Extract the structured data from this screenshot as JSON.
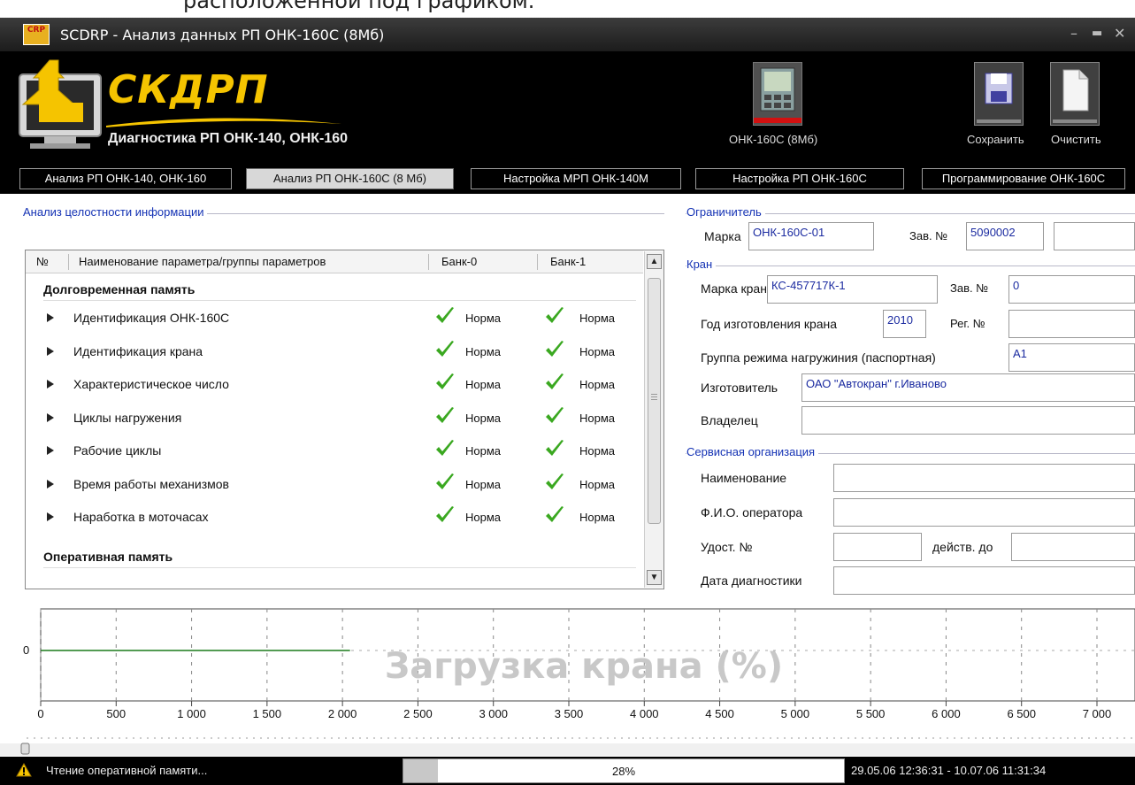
{
  "doc_caption": "расположенной под графиком.",
  "window": {
    "icon_text": "CRP",
    "title": "SCDRP - Анализ данных РП ОНК-160С (8Мб)"
  },
  "header": {
    "logo_text": "СКДРП",
    "subtitle": "Диагностика РП ОНК-140, ОНК-160",
    "device_label": "ОНК-160С (8Мб)",
    "save_label": "Сохранить",
    "clear_label": "Очистить"
  },
  "tabs": [
    {
      "label": "Анализ РП ОНК-140, ОНК-160",
      "active": false
    },
    {
      "label": "Анализ РП ОНК-160С (8 Мб)",
      "active": true
    },
    {
      "label": "Настройка МРП ОНК-140М",
      "active": false
    },
    {
      "label": "Настройка РП ОНК-160С",
      "active": false
    },
    {
      "label": "Программирование ОНК-160С",
      "active": false
    }
  ],
  "integrity": {
    "title": "Анализ целостности информации",
    "columns": [
      "№",
      "Наименование параметра/группы параметров",
      "Банк-0",
      "Банк-1"
    ],
    "section1": "Долговременная память",
    "rows": [
      {
        "name": "Идентификация ОНК-160С",
        "bank0": "Норма",
        "bank1": "Норма"
      },
      {
        "name": "Идентификация крана",
        "bank0": "Норма",
        "bank1": "Норма"
      },
      {
        "name": "Характеристическое число",
        "bank0": "Норма",
        "bank1": "Норма"
      },
      {
        "name": "Циклы нагружения",
        "bank0": "Норма",
        "bank1": "Норма"
      },
      {
        "name": "Рабочие циклы",
        "bank0": "Норма",
        "bank1": "Норма"
      },
      {
        "name": "Время работы механизмов",
        "bank0": "Норма",
        "bank1": "Норма"
      },
      {
        "name": "Наработка в моточасах",
        "bank0": "Норма",
        "bank1": "Норма"
      }
    ],
    "section2": "Оперативная память"
  },
  "limiter": {
    "title": "Ограничитель",
    "mark_label": "Марка",
    "mark_value": "ОНК-160С-01",
    "serial_label": "Зав. №",
    "serial_value": "5090002",
    "extra_value": ""
  },
  "crane": {
    "title": "Кран",
    "mark_label": "Марка крана",
    "mark_value": "КС-457717К-1",
    "serial_label": "Зав. №",
    "serial_value": "0",
    "year_label": "Год изготовления крана",
    "year_value": "2010",
    "reg_label": "Рег. №",
    "reg_value": "",
    "group_label": "Группа режима нагружиния (паспортная)",
    "group_value": "А1",
    "maker_label": "Изготовитель",
    "maker_value": "ОАО \"Автокран\" г.Иваново",
    "owner_label": "Владелец",
    "owner_value": ""
  },
  "service": {
    "title": "Сервисная организация",
    "name_label": "Наименование",
    "name_value": "",
    "operator_label": "Ф.И.О. оператора",
    "operator_value": "",
    "cert_label": "Удост. №",
    "cert_value": "",
    "valid_label": "действ. до",
    "valid_value": "",
    "date_label": "Дата диагностики",
    "date_value": ""
  },
  "chart_data": {
    "type": "line",
    "title": "Загрузка крана (%)",
    "xlim": [
      0,
      7000
    ],
    "x_ticks": [
      0,
      500,
      1000,
      1500,
      2000,
      2500,
      3000,
      3500,
      4000,
      4500,
      5000,
      5500,
      6000,
      6500,
      7000
    ],
    "x_tick_labels": [
      "0",
      "500",
      "1 000",
      "1 500",
      "2 000",
      "2 500",
      "3 000",
      "3 500",
      "4 000",
      "4 500",
      "5 000",
      "5 500",
      "6 000",
      "6 500",
      "7 000"
    ],
    "y_ticks": [
      0
    ],
    "y_tick_labels": [
      "0"
    ],
    "grid": true,
    "series": [
      {
        "color": "#1a7a1a",
        "x": [
          0,
          2050
        ],
        "y": [
          0,
          0
        ]
      }
    ]
  },
  "status": {
    "message": "Чтение оперативной памяти...",
    "progress_text": "28%",
    "progress": 0.28,
    "date_range": "29.05.06 12:36:31 - 10.07.06 11:31:34"
  },
  "colors": {
    "accent_yellow": "#f5c400",
    "group_title": "#1432b4",
    "check_green": "#3aa820",
    "series_green": "#1a7a1a"
  }
}
